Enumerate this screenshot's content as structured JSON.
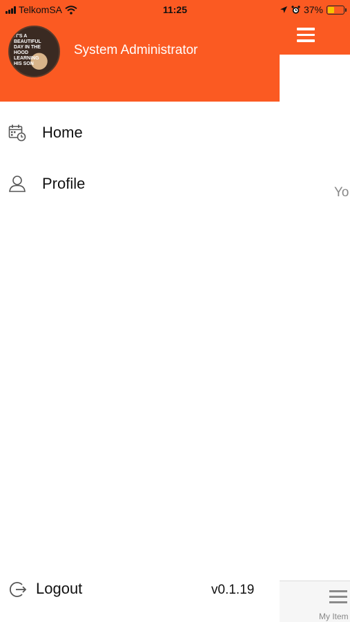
{
  "status_bar": {
    "carrier": "TelkomSA",
    "time": "11:25",
    "battery_percent": "37%",
    "icons": [
      "signal-icon",
      "wifi-icon",
      "location-icon",
      "alarm-icon",
      "battery-icon"
    ]
  },
  "drawer": {
    "user_name": "System Administrator",
    "avatar_text": "IT'S A BEAUTIFUL DAY IN THE HOOD LEARNING HIS SON",
    "menu": [
      {
        "label": "Home",
        "icon": "calendar-clock-icon"
      },
      {
        "label": "Profile",
        "icon": "user-icon"
      }
    ],
    "logout_label": "Logout",
    "logout_icon": "logout-icon",
    "version": "v0.1.19"
  },
  "background": {
    "partial_text": "Yo",
    "tab_label": "My Item",
    "menu_icon": "hamburger-icon"
  },
  "colors": {
    "accent": "#fb5a22",
    "battery": "#f5c400"
  }
}
